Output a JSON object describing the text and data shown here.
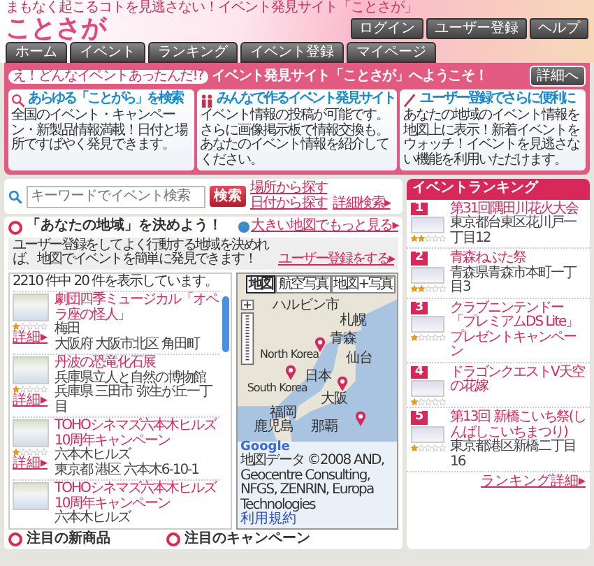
{
  "header": {
    "tagline": "まもなく起こるコトを見逃さない！イベント発見サイト「ことさが」",
    "logo": "ことさが",
    "account_buttons": [
      "ログイン",
      "ユーザー登録",
      "ヘルプ"
    ],
    "nav_tabs": [
      "ホーム",
      "イベント",
      "ランキング",
      "イベント登録",
      "マイページ"
    ]
  },
  "welcome": {
    "bubble": "え！どんなイベントあったんだ!?",
    "title": "イベント発見サイト「ことさが」へようこそ！",
    "details_button": "詳細へ",
    "features": [
      {
        "kind": "search",
        "title": "あらゆる「ことがら」を検索",
        "body": "全国のイベント・キャンペーン・新製品情報満載！日付と場所ですばやく発見できます。"
      },
      {
        "kind": "people",
        "title": "みんなで作るイベント発見サイト",
        "body": "イベント情報の投稿が可能です。さらに画像掲示板で情報交換も。あなたのイベント情報を紹介してください。"
      },
      {
        "kind": "pen",
        "title": "ユーザー登録でさらに便利に",
        "body": "あなたの地域のイベント情報を地図上に表示！新着イベントをウォッチ！イベントを見逃さない機能を利用いただけます。"
      }
    ]
  },
  "search": {
    "placeholder": "キーワードでイベント検索",
    "button": "検索",
    "links": [
      "場所から探す",
      "日付から探す",
      "詳細検索▸"
    ]
  },
  "region": {
    "title": "「あなたの地域」を決めよう！",
    "notice": "ユーザー登録をしてよく行動する地域を決めれば、地図でイベントを簡単に発見できます！",
    "register_link": "ユーザー登録をする▸",
    "large_map_link": "大きい地図でもっと見る▸",
    "result_count": "2210 件中 20 件を表示しています。",
    "events": [
      {
        "title": "劇団四季ミュージカル「オペラ座の怪人」",
        "venue": "梅田",
        "address": "大阪府 大阪市北区 角田町",
        "stars": 1,
        "details_link": "詳細▸"
      },
      {
        "title": "丹波の恐竜化石展",
        "venue": "兵庫県立人と自然の博物館",
        "address": "兵庫県 三田市 弥生が丘一丁目",
        "stars": 1,
        "details_link": "詳細▸"
      },
      {
        "title": "TOHOシネマズ六本木ヒルズ 10周年キャンペーン",
        "venue": "六本木ヒルズ",
        "address": "東京都 港区 六本木6-10-1",
        "stars": 1,
        "details_link": "詳細▸"
      },
      {
        "title": "TOHOシネマズ六本木ヒルズ10周年キャンペーン",
        "venue": "六本木ヒルズ"
      }
    ],
    "map": {
      "types": [
        {
          "label": "地図",
          "selected": true
        },
        {
          "label": "航空写真",
          "selected": false
        },
        {
          "label": "地図+写真",
          "selected": false
        }
      ],
      "places": [
        "ハルビン市",
        "札幌",
        "青森",
        "North Korea",
        "仙台",
        "日本",
        "South Korea",
        "大阪",
        "福岡",
        "鹿児島",
        "那覇"
      ],
      "logo_text": "Google",
      "attribution": "地図データ ©2008 AND, Geocentre Consulting, NFGS, ZENRIN, Europa Technologies",
      "terms_link": "利用規約"
    },
    "sections": [
      "注目の新商品",
      "注目のキャンペーン"
    ]
  },
  "ranking": {
    "title": "イベントランキング",
    "items": [
      {
        "rank": "1",
        "title": "第31回隅田川花火大会",
        "address": "東京都台東区花川戸一丁目12",
        "stars": 2
      },
      {
        "rank": "2",
        "title": "青森ねぶた祭",
        "address": "青森県青森市本町一丁目3",
        "stars": 2
      },
      {
        "rank": "3",
        "title": "クラブニンテンドー「プレミアムDS Lite」プレゼントキャンペーン",
        "stars": 1
      },
      {
        "rank": "4",
        "title": "ドラゴンクエストV天空の花嫁",
        "stars": 1
      },
      {
        "rank": "5",
        "title": "第13回 新橋こいち祭(しんばしこいちまつり)",
        "address": "東京都港区新橋二丁目16",
        "stars": 1
      }
    ],
    "more_link": "ランキング詳細▸"
  }
}
